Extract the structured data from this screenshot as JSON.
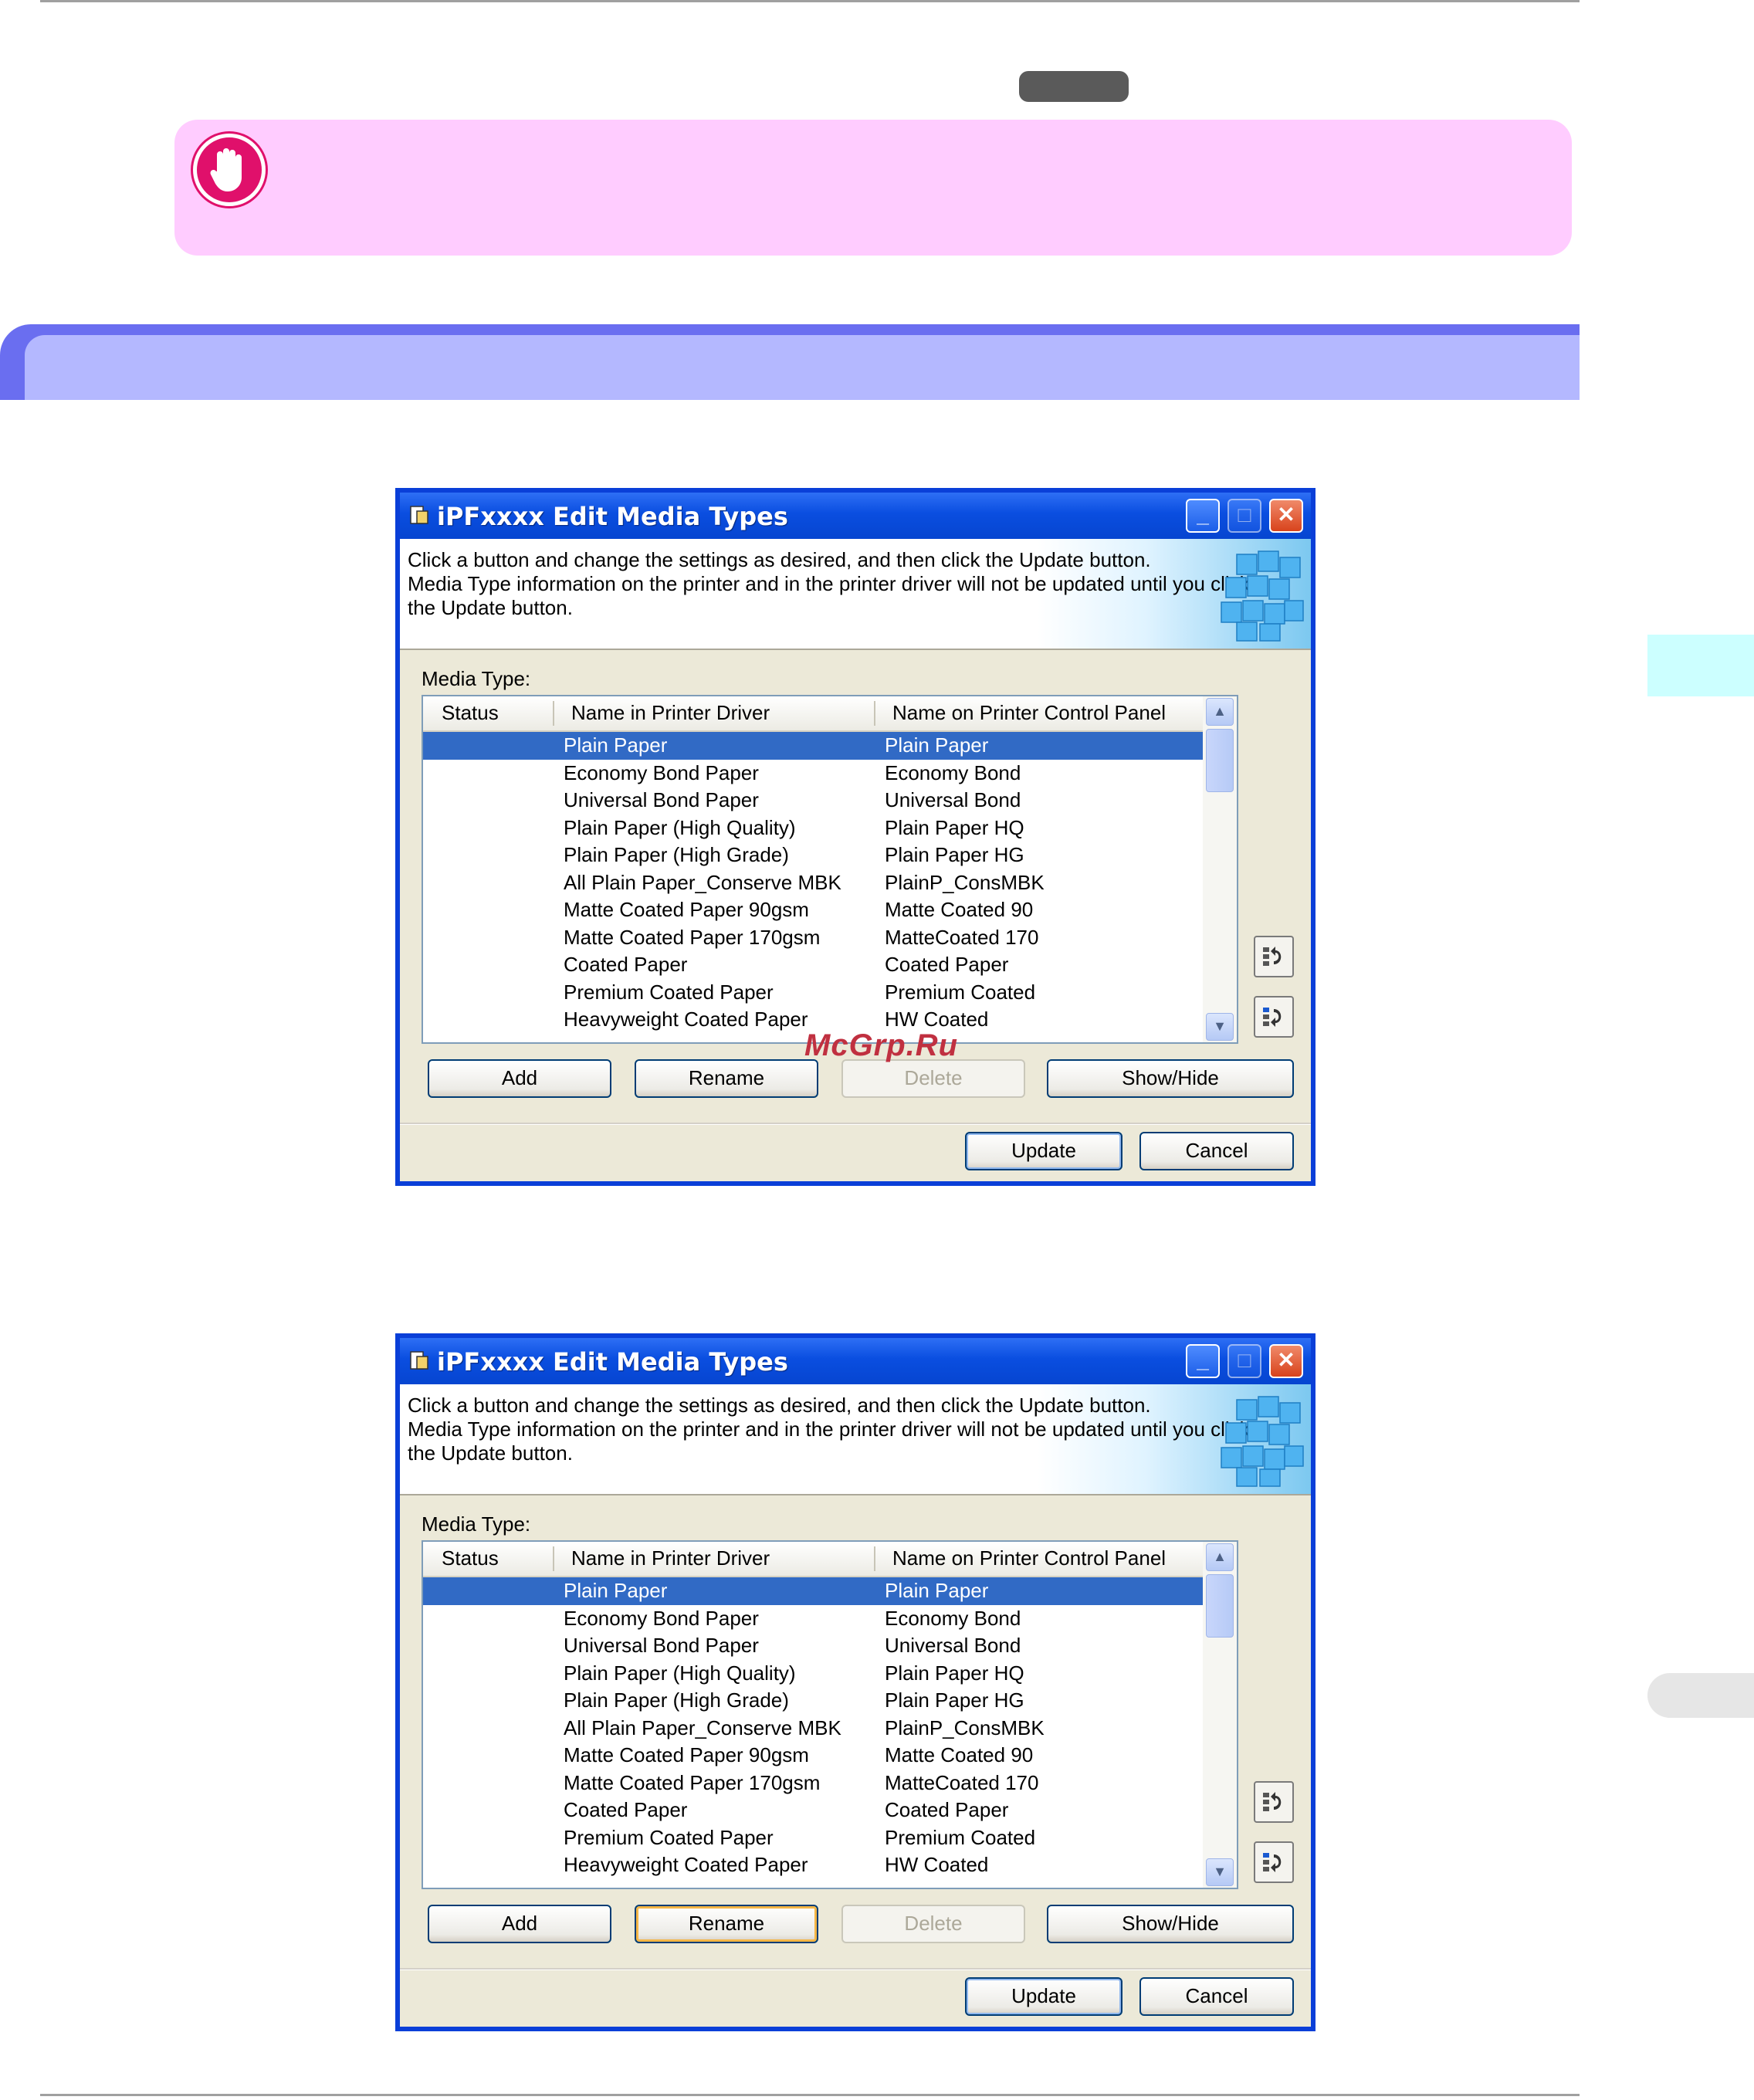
{
  "watermark": "McGrp.Ru",
  "dialogs": [
    {
      "title": "iPFxxxx Edit Media Types",
      "banner_text": "Click a button and change the settings as desired, and then click the Update button.\nMedia Type information on the printer and in the printer driver will not be updated until you click\nthe Update button.",
      "media_type_label": "Media Type:",
      "columns": [
        "Status",
        "Name in Printer Driver",
        "Name on Printer Control Panel"
      ],
      "rows": [
        {
          "driver": "Plain Paper",
          "panel": "Plain Paper"
        },
        {
          "driver": "Economy Bond Paper",
          "panel": "Economy Bond"
        },
        {
          "driver": "Universal Bond Paper",
          "panel": "Universal Bond"
        },
        {
          "driver": "Plain Paper (High Quality)",
          "panel": "Plain Paper HQ"
        },
        {
          "driver": "Plain Paper (High Grade)",
          "panel": "Plain Paper HG"
        },
        {
          "driver": "All Plain Paper_Conserve MBK",
          "panel": "PlainP_ConsMBK"
        },
        {
          "driver": "Matte Coated Paper 90gsm",
          "panel": "Matte Coated 90"
        },
        {
          "driver": "Matte Coated Paper 170gsm",
          "panel": "MatteCoated 170"
        },
        {
          "driver": "Coated Paper",
          "panel": "Coated Paper"
        },
        {
          "driver": "Premium Coated Paper",
          "panel": "Premium Coated"
        },
        {
          "driver": "Heavyweight Coated Paper",
          "panel": "HW Coated"
        }
      ],
      "buttons": {
        "add": "Add",
        "rename": "Rename",
        "delete": "Delete",
        "show_hide": "Show/Hide",
        "update": "Update",
        "cancel": "Cancel"
      }
    },
    {
      "title": "iPFxxxx Edit Media Types",
      "banner_text": "Click a button and change the settings as desired, and then click the Update button.\nMedia Type information on the printer and in the printer driver will not be updated until you click\nthe Update button.",
      "media_type_label": "Media Type:",
      "columns": [
        "Status",
        "Name in Printer Driver",
        "Name on Printer Control Panel"
      ],
      "rows": [
        {
          "driver": "Plain Paper",
          "panel": "Plain Paper"
        },
        {
          "driver": "Economy Bond Paper",
          "panel": "Economy Bond"
        },
        {
          "driver": "Universal Bond Paper",
          "panel": "Universal Bond"
        },
        {
          "driver": "Plain Paper (High Quality)",
          "panel": "Plain Paper HQ"
        },
        {
          "driver": "Plain Paper (High Grade)",
          "panel": "Plain Paper HG"
        },
        {
          "driver": "All Plain Paper_Conserve MBK",
          "panel": "PlainP_ConsMBK"
        },
        {
          "driver": "Matte Coated Paper 90gsm",
          "panel": "Matte Coated 90"
        },
        {
          "driver": "Matte Coated Paper 170gsm",
          "panel": "MatteCoated 170"
        },
        {
          "driver": "Coated Paper",
          "panel": "Coated Paper"
        },
        {
          "driver": "Premium Coated Paper",
          "panel": "Premium Coated"
        },
        {
          "driver": "Heavyweight Coated Paper",
          "panel": "HW Coated"
        }
      ],
      "buttons": {
        "add": "Add",
        "rename": "Rename",
        "delete": "Delete",
        "show_hide": "Show/Hide",
        "update": "Update",
        "cancel": "Cancel"
      }
    }
  ]
}
